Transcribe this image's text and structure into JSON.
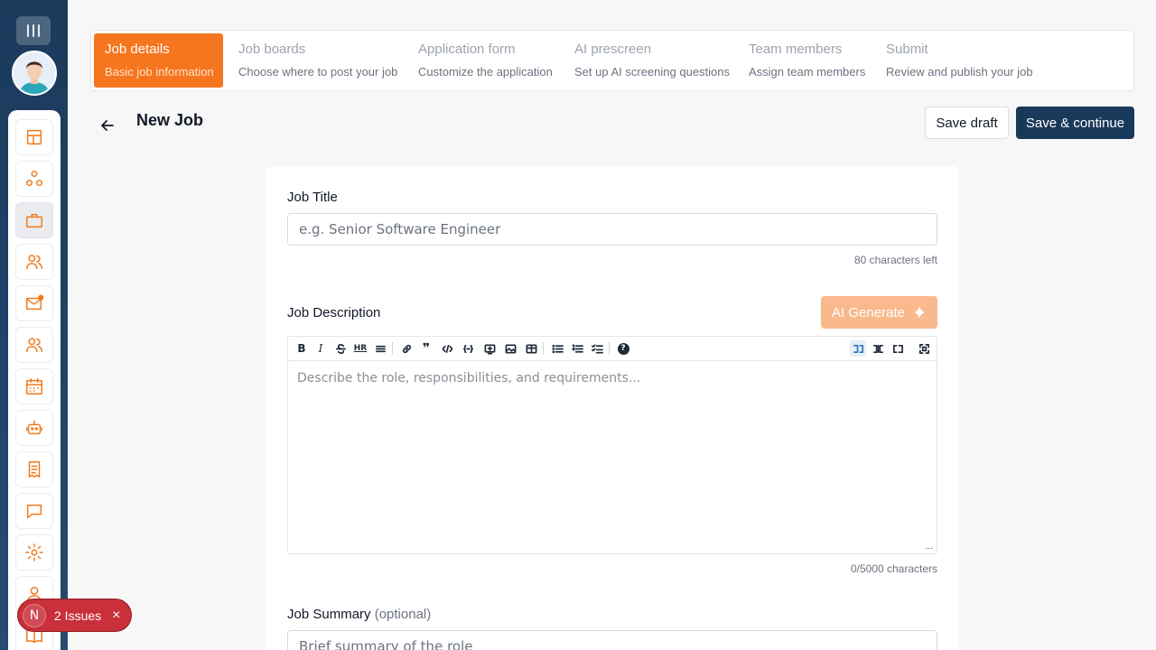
{
  "stepper": [
    {
      "title": "Job details",
      "subtitle": "Basic job information",
      "active": true
    },
    {
      "title": "Job boards",
      "subtitle": "Choose where to post your job",
      "active": false
    },
    {
      "title": "Application form",
      "subtitle": "Customize the application",
      "active": false
    },
    {
      "title": "AI prescreen",
      "subtitle": "Set up AI screening questions",
      "active": false
    },
    {
      "title": "Team members",
      "subtitle": "Assign team members",
      "active": false
    },
    {
      "title": "Submit",
      "subtitle": "Review and publish your job",
      "active": false
    }
  ],
  "header": {
    "title": "New Job",
    "save_draft": "Save draft",
    "save_continue": "Save & continue"
  },
  "form": {
    "job_title": {
      "label": "Job Title",
      "placeholder": "e.g. Senior Software Engineer",
      "value": "",
      "hint": "80 characters left"
    },
    "job_description": {
      "label": "Job Description",
      "ai_button": "AI Generate",
      "placeholder": "Describe the role, responsibilities, and requirements...",
      "hint": "0/5000 characters",
      "toolbar_bold": "B",
      "toolbar_italic": "I",
      "toolbar_hr": "HR",
      "toolbar_quote": "❞",
      "toolbar_help": "?",
      "resize": "..."
    },
    "job_summary": {
      "label": "Job Summary",
      "optional": "(optional)",
      "placeholder": "Brief summary of the role"
    }
  },
  "issues": {
    "badge": "N",
    "label": "2 Issues",
    "close": "×"
  },
  "colors": {
    "accent": "#f5761f",
    "primary": "#19395a",
    "rail": "#1b3a5c",
    "issues": "#c9303a"
  }
}
